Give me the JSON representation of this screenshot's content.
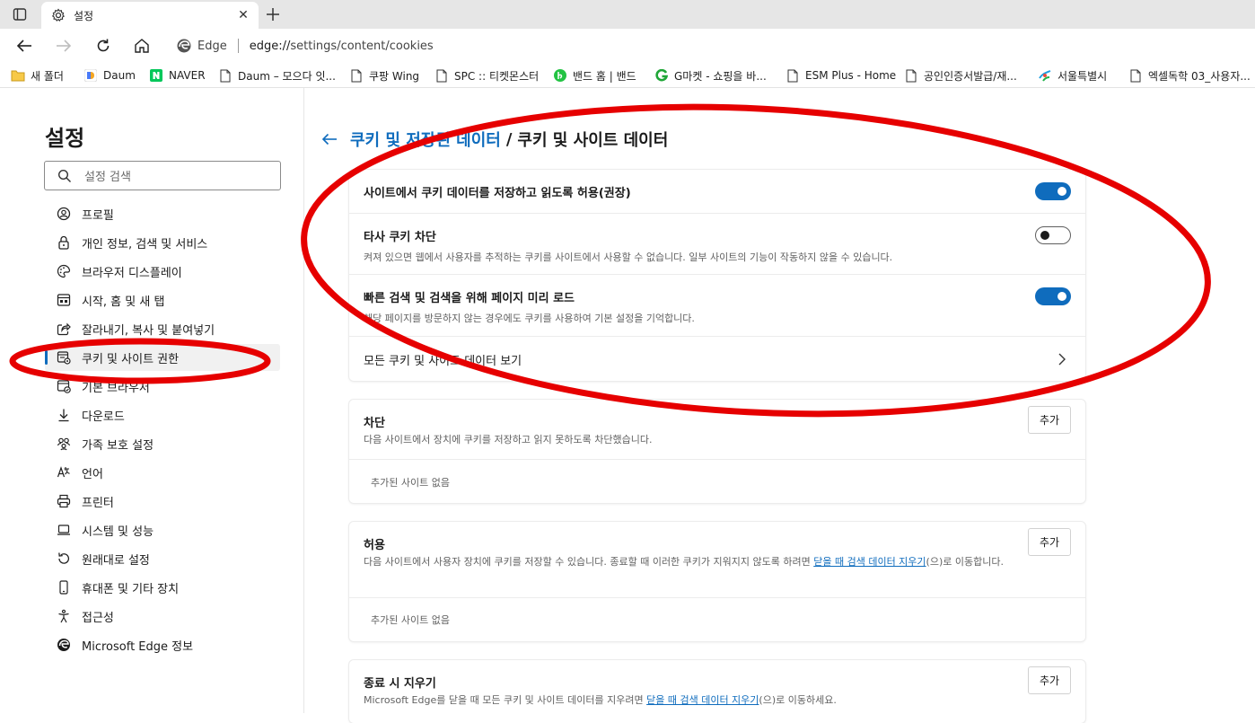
{
  "browser": {
    "tab_title": "설정",
    "address_brand": "Edge",
    "address_url_host": "edge://",
    "address_url_path": "settings/content/cookies"
  },
  "favorites": [
    {
      "label": "새 폴더",
      "icon": "folder-icon"
    },
    {
      "label": "Daum",
      "icon": "daum-icon"
    },
    {
      "label": "NAVER",
      "icon": "naver-icon"
    },
    {
      "label": "Daum – 모으다 잇...",
      "icon": "page-icon"
    },
    {
      "label": "쿠팡 Wing",
      "icon": "page-icon"
    },
    {
      "label": "SPC :: 티켓몬스터",
      "icon": "page-icon"
    },
    {
      "label": "밴드 홈 | 밴드",
      "icon": "band-icon"
    },
    {
      "label": "G마켓 - 쇼핑을 바...",
      "icon": "gmarket-icon"
    },
    {
      "label": "ESM Plus - Home",
      "icon": "page-icon"
    },
    {
      "label": "공인인증서발급/재...",
      "icon": "page-icon"
    },
    {
      "label": "서울특별시",
      "icon": "seoul-icon"
    },
    {
      "label": "엑셀독학 03_사용자...",
      "icon": "page-icon"
    }
  ],
  "sidebar": {
    "title": "설정",
    "search_placeholder": "설정 검색",
    "items": [
      {
        "label": "프로필",
        "icon": "profile-icon"
      },
      {
        "label": "개인 정보, 검색 및 서비스",
        "icon": "lock-icon"
      },
      {
        "label": "브라우저 디스플레이",
        "icon": "palette-icon"
      },
      {
        "label": "시작, 홈 및 새 탭",
        "icon": "home-tab-icon"
      },
      {
        "label": "잘라내기, 복사 및 붙여넣기",
        "icon": "share-icon"
      },
      {
        "label": "쿠키 및 사이트 권한",
        "icon": "cookie-settings-icon",
        "active": true
      },
      {
        "label": "기본 브라우저",
        "icon": "default-browser-icon"
      },
      {
        "label": "다운로드",
        "icon": "download-icon"
      },
      {
        "label": "가족 보호 설정",
        "icon": "family-icon"
      },
      {
        "label": "언어",
        "icon": "language-icon"
      },
      {
        "label": "프린터",
        "icon": "printer-icon"
      },
      {
        "label": "시스템 및 성능",
        "icon": "laptop-icon"
      },
      {
        "label": "원래대로 설정",
        "icon": "reset-icon"
      },
      {
        "label": "휴대폰 및 기타 장치",
        "icon": "phone-icon"
      },
      {
        "label": "접근성",
        "icon": "accessibility-icon"
      },
      {
        "label": "Microsoft Edge 정보",
        "icon": "edge-icon"
      }
    ]
  },
  "main": {
    "breadcrumb_parent": "쿠키 및 저장된 데이터",
    "breadcrumb_sep": "/",
    "breadcrumb_current": "쿠키 및 사이트 데이터",
    "settings": [
      {
        "title": "사이트에서 쿠키 데이터를 저장하고 읽도록 허용(권장)",
        "desc": "",
        "enabled": true
      },
      {
        "title": "타사 쿠키 차단",
        "desc": "켜져 있으면 웹에서 사용자를 추적하는 쿠키를 사이트에서 사용할 수 없습니다. 일부 사이트의 기능이 작동하지 않을 수 있습니다.",
        "enabled": false
      },
      {
        "title": "빠른 검색 및 검색을 위해 페이지 미리 로드",
        "desc": "해당 페이지를 방문하지 않는 경우에도 쿠키를 사용하여 기본 설정을 기억합니다.",
        "enabled": true
      }
    ],
    "see_all_label": "모든 쿠키 및 사이트 데이터 보기",
    "block": {
      "title": "차단",
      "desc": "다음 사이트에서 장치에 쿠키를 저장하고 읽지 못하도록 차단했습니다.",
      "add_label": "추가",
      "empty": "추가된 사이트 없음"
    },
    "allow": {
      "title": "허용",
      "desc_before": "다음 사이트에서 사용자 장치에 쿠키를 저장할 수 있습니다. 종료할 때 이러한 쿠키가 지워지지 않도록 하려면 ",
      "desc_link": "닫을 때 검색 데이터 지우기",
      "desc_after": "(으)로 이동합니다.",
      "add_label": "추가",
      "empty": "추가된 사이트 없음"
    },
    "clear_on_exit": {
      "title": "종료 시 지우기",
      "desc_before": "Microsoft Edge를 닫을 때 모든 쿠키 및 사이트 데이터를 지우려면 ",
      "desc_link": "닫을 때 검색 데이터 지우기",
      "desc_after": "(으)로 이동하세요.",
      "add_label": "추가"
    }
  },
  "colors": {
    "accent": "#0f6cbd",
    "annotation": "#e60000"
  }
}
